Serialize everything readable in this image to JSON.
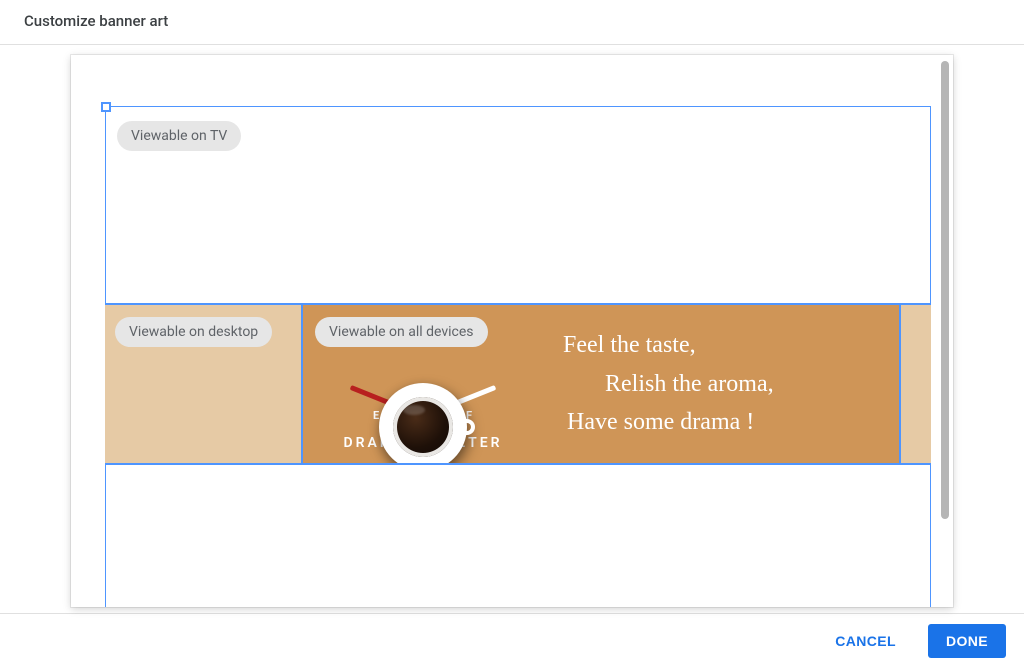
{
  "header": {
    "title": "Customize banner art"
  },
  "labels": {
    "tv": "Viewable on TV",
    "desktop": "Viewable on desktop",
    "all": "Viewable on all devices"
  },
  "banner": {
    "gauge": {
      "left_tick": "E",
      "right_tick": "F"
    },
    "logo": {
      "part1": "DRAMA-",
      "part2": "-METER"
    },
    "tagline": {
      "line1": "Feel the taste,",
      "line2": "Relish the aroma,",
      "line3": "Have some drama !"
    },
    "colors": {
      "safe_bg": "#cf9557",
      "desktop_bg": "#e6caa5",
      "frame": "#4e95ff"
    }
  },
  "footer": {
    "cancel": "CANCEL",
    "done": "DONE"
  }
}
